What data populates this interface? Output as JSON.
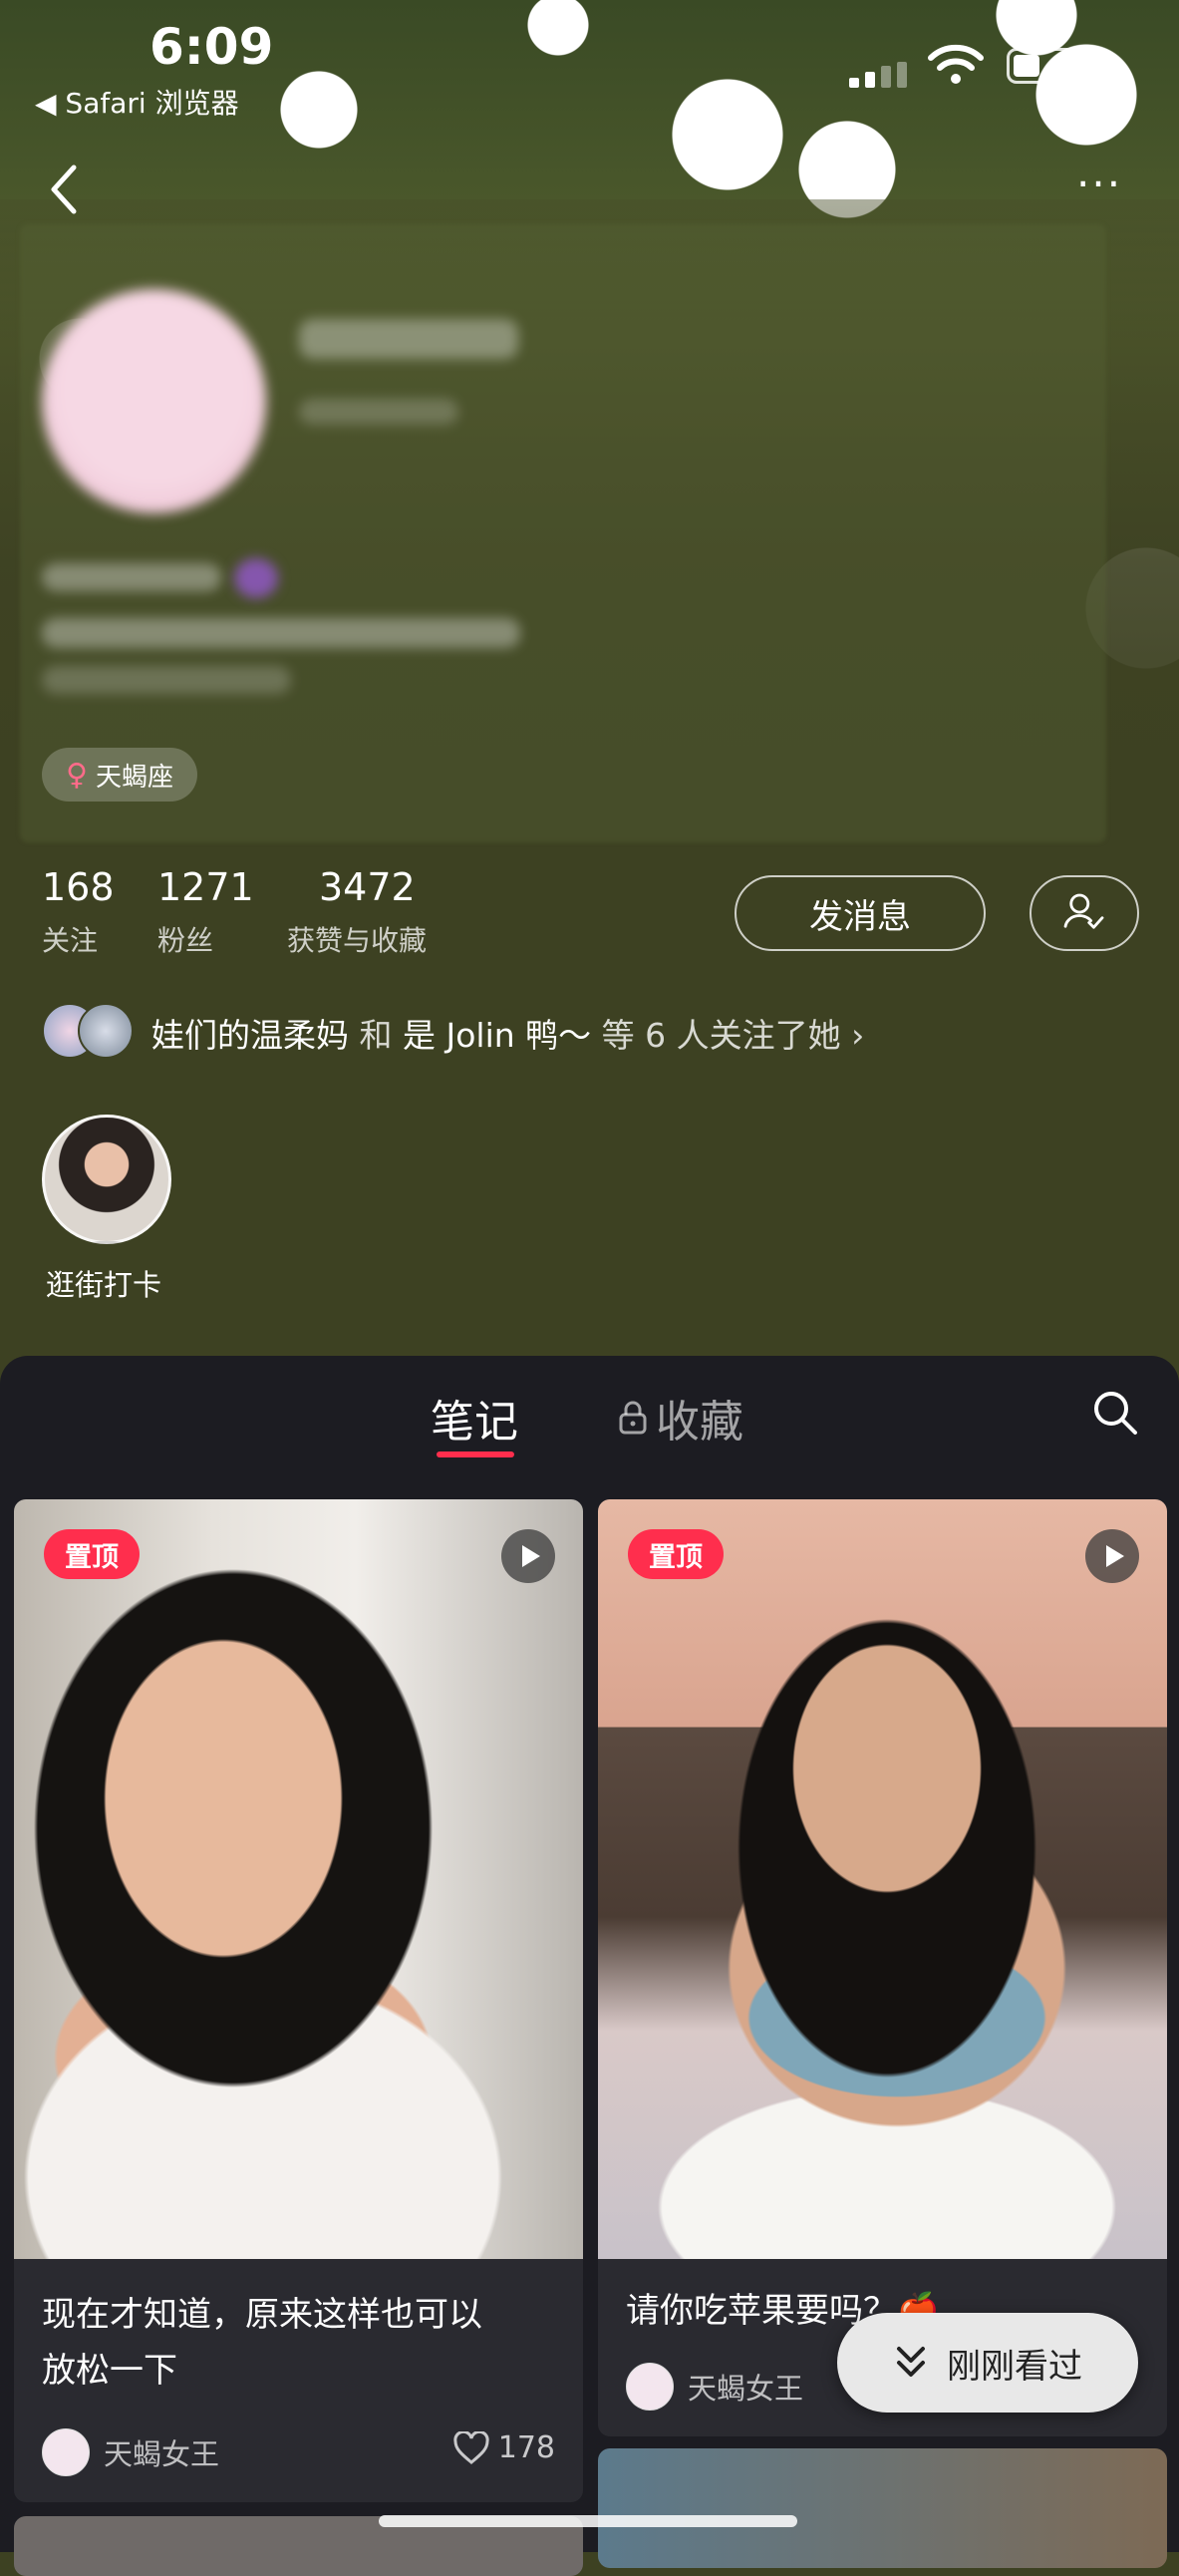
{
  "status_bar": {
    "time": "6:09",
    "back_app": "◀ Safari 浏览器"
  },
  "profile": {
    "zodiac": "天蝎座",
    "stats": [
      {
        "value": "168",
        "label": "关注"
      },
      {
        "value": "1271",
        "label": "粉丝"
      },
      {
        "value": "3472",
        "label": "获赞与收藏"
      }
    ],
    "message_button": "发消息",
    "followers_line": {
      "name1": "娃们的温柔妈",
      "and": "和",
      "name2": "是 Jolin 鸭～",
      "suffix": "等 6 人关注了她"
    },
    "highlight_label": "逛街打卡"
  },
  "tabs": {
    "active": "笔记",
    "locked": "收藏"
  },
  "cards": [
    {
      "pin": "置顶",
      "title_line1": "现在才知道，原来这样也可以",
      "title_line2": "放松一下",
      "author": "天蝎女王",
      "likes": "178"
    },
    {
      "pin": "置顶",
      "title_line1": "请你吃苹果要吗？🍎",
      "author": "天蝎女王"
    }
  ],
  "recent_button": "刚刚看过",
  "colors": {
    "accent": "#ff2e4d",
    "header_bg": "#3d4122",
    "content_bg": "#1c1c22"
  }
}
